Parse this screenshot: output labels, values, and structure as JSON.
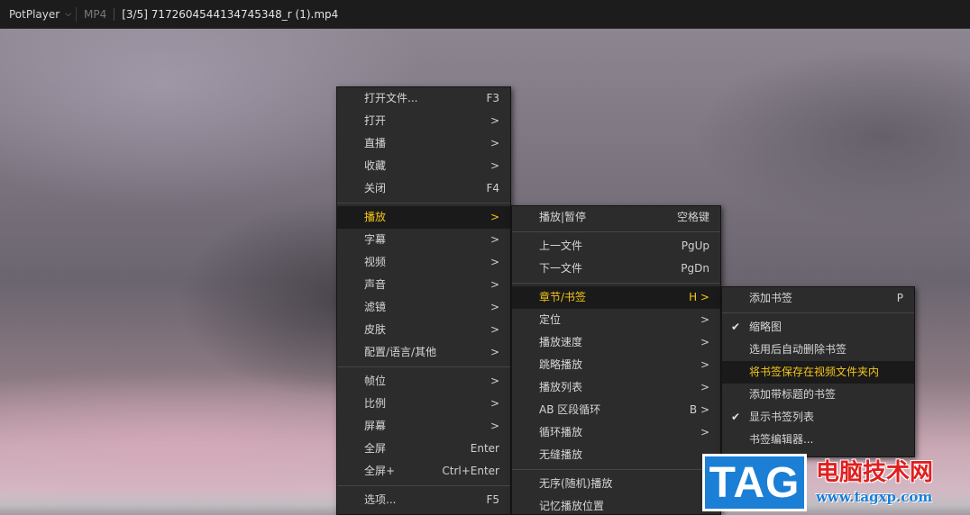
{
  "titlebar": {
    "app_name": "PotPlayer",
    "app_chevron": "⌵",
    "format": "MP4",
    "file_title": "[3/5] 7172604544134745348_r (1).mp4"
  },
  "menu_main": {
    "group1": [
      {
        "label": "打开文件...",
        "shortcut": "F3"
      },
      {
        "label": "打开",
        "shortcut": ">"
      },
      {
        "label": "直播",
        "shortcut": ">"
      },
      {
        "label": "收藏",
        "shortcut": ">"
      },
      {
        "label": "关闭",
        "shortcut": "F4"
      }
    ],
    "group2": [
      {
        "label": "播放",
        "shortcut": ">"
      },
      {
        "label": "字幕",
        "shortcut": ">"
      },
      {
        "label": "视频",
        "shortcut": ">"
      },
      {
        "label": "声音",
        "shortcut": ">"
      },
      {
        "label": "滤镜",
        "shortcut": ">"
      },
      {
        "label": "皮肤",
        "shortcut": ">"
      },
      {
        "label": "配置/语言/其他",
        "shortcut": ">"
      }
    ],
    "group3": [
      {
        "label": "帧位",
        "shortcut": ">"
      },
      {
        "label": "比例",
        "shortcut": ">"
      },
      {
        "label": "屏幕",
        "shortcut": ">"
      },
      {
        "label": "全屏",
        "shortcut": "Enter"
      },
      {
        "label": "全屏+",
        "shortcut": "Ctrl+Enter"
      }
    ],
    "group4": [
      {
        "label": "选项...",
        "shortcut": "F5"
      }
    ]
  },
  "menu_play": {
    "group1": [
      {
        "label": "播放|暂停",
        "shortcut": "空格键"
      }
    ],
    "group2": [
      {
        "label": "上一文件",
        "shortcut": "PgUp"
      },
      {
        "label": "下一文件",
        "shortcut": "PgDn"
      }
    ],
    "group3": [
      {
        "label": "章节/书签",
        "shortcut": "H >"
      },
      {
        "label": "定位",
        "shortcut": ">"
      },
      {
        "label": "播放速度",
        "shortcut": ">"
      },
      {
        "label": "跳略播放",
        "shortcut": ">"
      },
      {
        "label": "播放列表",
        "shortcut": ">"
      },
      {
        "label": "AB 区段循环",
        "shortcut": "B >"
      },
      {
        "label": "循环播放",
        "shortcut": ">"
      },
      {
        "label": "无缝播放",
        "shortcut": ""
      }
    ],
    "group4": [
      {
        "label": "无序(随机)播放",
        "shortcut": ""
      },
      {
        "label": "记忆播放位置",
        "shortcut": ""
      }
    ]
  },
  "menu_bookmarks": {
    "group1": [
      {
        "label": "添加书签",
        "shortcut": "P"
      }
    ],
    "group2": [
      {
        "label": "缩略图",
        "shortcut": "",
        "checked": true
      },
      {
        "label": "选用后自动删除书签",
        "shortcut": "",
        "checked": false
      },
      {
        "label": "将书签保存在视频文件夹内",
        "shortcut": "",
        "checked": false
      },
      {
        "label": "添加带标题的书签",
        "shortcut": "",
        "checked": false
      },
      {
        "label": "显示书签列表",
        "shortcut": "",
        "checked": true
      },
      {
        "label": "书签编辑器...",
        "shortcut": "",
        "checked": false
      }
    ]
  },
  "watermark": {
    "tag": "TAG",
    "site_name": "电脑技术网",
    "url": "www.tagxp.com"
  },
  "colors": {
    "highlight_text": "#f5c518",
    "menu_bg": "#2c2c2c",
    "watermark_blue": "#1b7fd6",
    "watermark_red": "#e02020"
  }
}
